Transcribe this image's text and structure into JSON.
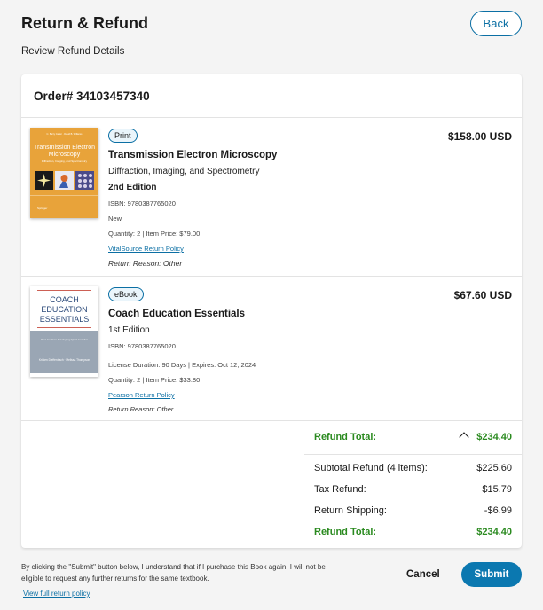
{
  "header": {
    "title": "Return & Refund",
    "back_label": "Back",
    "subtitle": "Review Refund Details"
  },
  "order": {
    "label": "Order# 34103457340"
  },
  "items": [
    {
      "badge": "Print",
      "title": "Transmission Electron Microscopy",
      "subtitle": "Diffraction, Imaging, and Spectrometry",
      "edition": "2nd Edition",
      "isbn": "ISBN: 9780387765020",
      "condition": "New",
      "quantity": "Quantity: 2  |  Item Price: $79.00",
      "policy": "VitalSource Return Policy",
      "reason": "Return Reason: Other",
      "price": "$158.00 USD",
      "cover": {
        "authors": "C. Barry Carter · David B. Williams",
        "title": "Transmission Electron Microscopy",
        "sub": "Diffraction, Imaging, and Spectrometry",
        "publisher": "Springer"
      }
    },
    {
      "badge": "eBook",
      "title": "Coach Education Essentials",
      "edition": "1st Edition",
      "isbn": "ISBN: 9780387765020",
      "license": "License Duration: 90 Days  |  Expires: Oct 12, 2024",
      "quantity": "Quantity: 2   |   Item Price: $33.80",
      "policy": "Pearson Return Policy",
      "reason": "Return Reason: Other",
      "price": "$67.60 USD",
      "cover": {
        "title_lines": [
          "COACH",
          "EDUCATION",
          "ESSENTIALS"
        ],
        "tagline": "Your Guide to Developing Sport Coaches",
        "authors": "Kristen Dieffenbach · Melissa Thompson"
      }
    }
  ],
  "totals": {
    "header_label": "Refund Total:",
    "header_value": "$234.40",
    "rows": [
      {
        "label": "Subtotal Refund (4 items):",
        "value": "$225.60"
      },
      {
        "label": "Tax Refund:",
        "value": "$15.79"
      },
      {
        "label": "Return Shipping:",
        "value": "-$6.99"
      }
    ],
    "footer_label": "Refund Total:",
    "footer_value": "$234.40"
  },
  "footer": {
    "disclaimer": "By clicking the \"Submit\" button below, I understand that if I purchase this Book again, I will not be eligible to request any further returns for the same textbook.",
    "policy_link": "View full return policy",
    "cancel": "Cancel",
    "submit": "Submit"
  },
  "colors": {
    "accent": "#0b78b0",
    "green": "#2a8a1f",
    "cover1": "#e8a33a"
  },
  "icons": [
    "chevron-up-icon"
  ]
}
